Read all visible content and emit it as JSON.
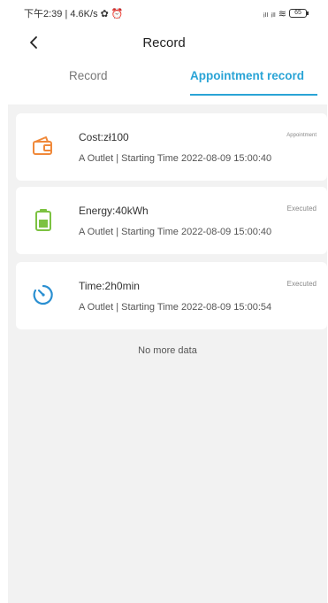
{
  "status_bar": {
    "time_info": "下午2:39 | 4.6K/s ✿ ⏰",
    "signal": "ᵢₗₗ ᵢₗₗ ≋",
    "battery": "65"
  },
  "header": {
    "title": "Record"
  },
  "tabs": [
    {
      "label": "Record",
      "active": false
    },
    {
      "label": "Appointment record",
      "active": true
    }
  ],
  "records": [
    {
      "icon": "wallet-icon",
      "title": "Cost:zł100",
      "subtitle": "A Outlet | Starting Time 2022-08-09 15:00:40",
      "status": "Appointment",
      "color": "#f0893a"
    },
    {
      "icon": "battery-icon",
      "title": "Energy:40kWh",
      "subtitle": "A Outlet | Starting Time 2022-08-09 15:00:40",
      "status": "Executed",
      "color": "#7cc241"
    },
    {
      "icon": "timer-icon",
      "title": "Time:2h0min",
      "subtitle": "A Outlet | Starting Time 2022-08-09 15:00:54",
      "status": "Executed",
      "color": "#2a8fd1"
    }
  ],
  "footer_text": "No more data",
  "colors": {
    "accent": "#2aa4d6",
    "background": "#f2f2f2"
  }
}
